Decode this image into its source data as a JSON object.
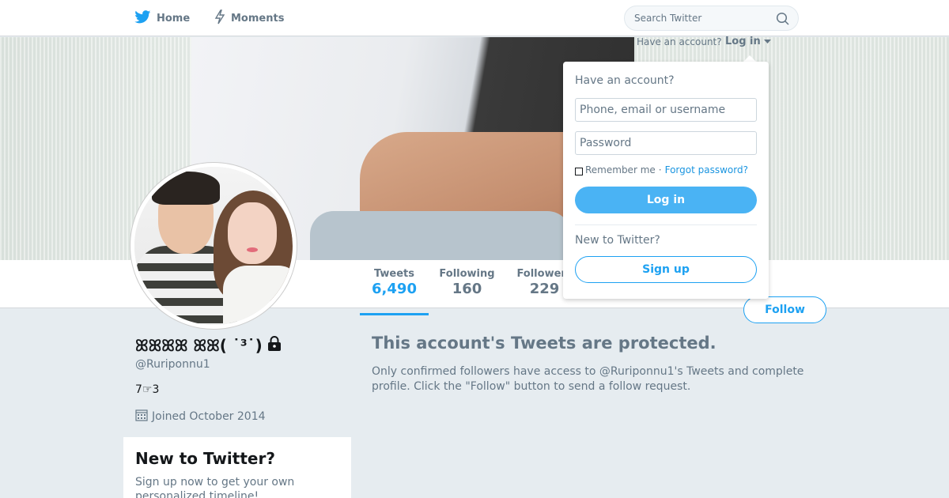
{
  "nav": {
    "home_label": "Home",
    "moments_label": "Moments",
    "search_placeholder": "Search Twitter"
  },
  "login_trigger": {
    "prompt": "Have an account?",
    "label": "Log in"
  },
  "profile": {
    "name": "ꕤꕤꕤꕤ ꕤꕤ( ˙³˙)",
    "screen_name": "@Ruriponnu1",
    "bio": "7☞3",
    "joined": "Joined October 2014"
  },
  "stats": [
    {
      "label": "Tweets",
      "value": "6,490"
    },
    {
      "label": "Following",
      "value": "160"
    },
    {
      "label": "Followers",
      "value": "229"
    }
  ],
  "follow_button": "Follow",
  "protected": {
    "title": "This account's Tweets are protected.",
    "text": "Only confirmed followers have access to @Ruriponnu1's Tweets and complete profile. Click the \"Follow\" button to send a follow request."
  },
  "signup_module": {
    "title": "New to Twitter?",
    "text": "Sign up now to get your own personalized timeline!"
  },
  "login_dropdown": {
    "heading": "Have an account?",
    "username_placeholder": "Phone, email or username",
    "password_placeholder": "Password",
    "remember_label": "Remember me",
    "separator": "·",
    "forgot_label": "Forgot password?",
    "login_button": "Log in",
    "new_label": "New to Twitter?",
    "signup_button": "Sign up"
  },
  "colors": {
    "accent": "#1da1f2",
    "muted": "#657786",
    "background": "#e6ecf0"
  }
}
